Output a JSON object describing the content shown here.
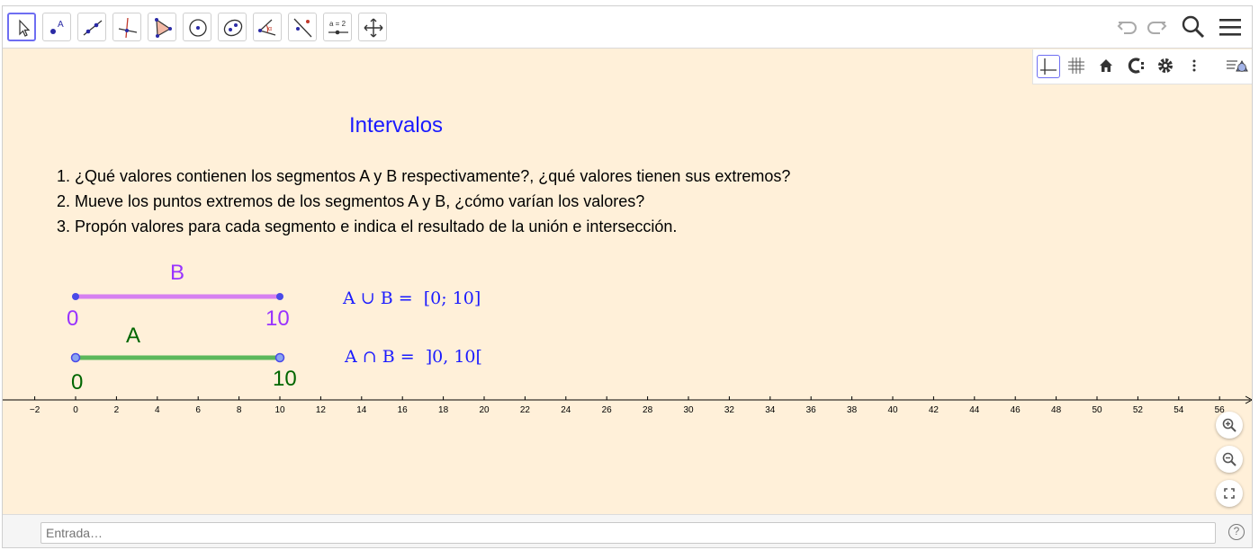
{
  "toolbar": {
    "tools": [
      {
        "name": "move-tool-icon",
        "active": true
      },
      {
        "name": "point-tool-icon"
      },
      {
        "name": "line-tool-icon"
      },
      {
        "name": "perpendicular-line-tool-icon"
      },
      {
        "name": "polygon-tool-icon"
      },
      {
        "name": "circle-tool-icon"
      },
      {
        "name": "ellipse-tool-icon"
      },
      {
        "name": "angle-tool-icon"
      },
      {
        "name": "reflect-tool-icon"
      },
      {
        "name": "slider-tool-icon",
        "label": "a = 2"
      },
      {
        "name": "move-graphics-view-tool-icon"
      }
    ],
    "right": [
      "undo-icon",
      "redo-icon",
      "search-icon",
      "menu-icon"
    ]
  },
  "style_bar": [
    "axes-icon",
    "grid-icon",
    "home-icon",
    "point-capturing-icon",
    "settings-icon",
    "more-icon",
    "toggle-style-bar-icon"
  ],
  "graphics": {
    "title": "Intervalos",
    "instructions": [
      "1. ¿Qué valores contienen los segmentos A y B respectivamente?, ¿qué valores tienen sus extremos?",
      "2. Mueve los puntos extremos de los segmentos A y B, ¿cómo varían los valores?",
      "3. Propón valores para cada segmento e indica el resultado de la unión e intersección."
    ],
    "segment_b": {
      "label": "B",
      "start_label": "0",
      "end_label": "10",
      "color": "#d680f0",
      "text_color": "#9933ff",
      "start": 0,
      "end": 10
    },
    "segment_a": {
      "label": "A",
      "start_label": "0",
      "end_label": "10",
      "color": "#5cb85c",
      "text_color": "#006600",
      "start": 0,
      "end": 10
    },
    "union": {
      "left": "A ∪ B =",
      "right": "[0; 10]"
    },
    "intersection": {
      "left": "A ∩ B =",
      "right": "]0, 10["
    },
    "axis": {
      "ticks": [
        "−2",
        "0",
        "2",
        "4",
        "6",
        "8",
        "10",
        "12",
        "14",
        "16",
        "18",
        "20",
        "22",
        "24",
        "26",
        "28",
        "30",
        "32",
        "34",
        "36",
        "38",
        "40",
        "42",
        "44",
        "46",
        "48",
        "50",
        "52",
        "54",
        "56"
      ]
    }
  },
  "zoom_controls": [
    "zoom-in-icon",
    "zoom-out-icon",
    "fullscreen-icon"
  ],
  "input_bar": {
    "placeholder": "Entrada…",
    "help": "?"
  }
}
